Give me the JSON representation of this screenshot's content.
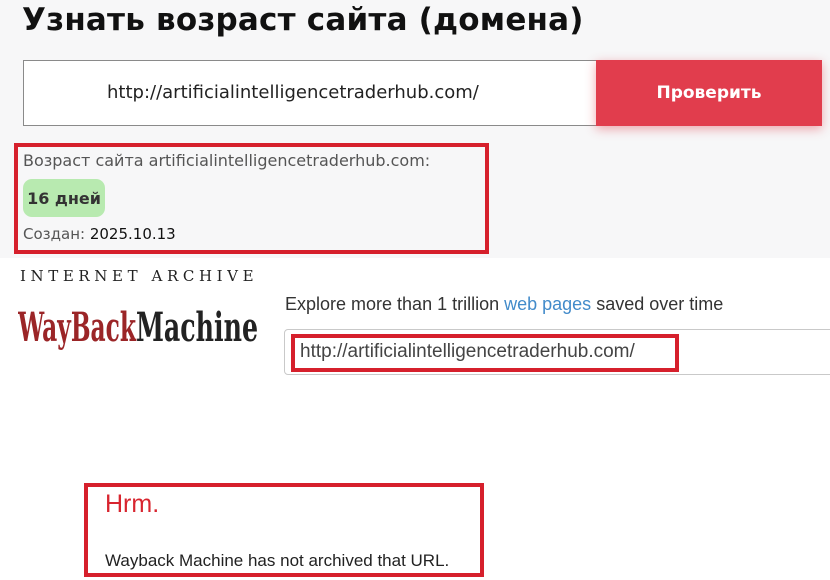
{
  "age_checker": {
    "title": "Узнать возраст сайта (домена)",
    "url_value": "http://artificialintelligencetraderhub.com/",
    "check_button": "Проверить",
    "age_label": "Возраст сайта artificialintelligencetraderhub.com:",
    "age_badge": "16 дней",
    "created_label": "Создан:",
    "created_date": "2025.10.13",
    "badge_color": "#b8eab0",
    "button_color": "#e13d4d",
    "highlight_color": "#d6202c"
  },
  "wayback": {
    "archive_label": "INTERNET ARCHIVE",
    "logo_text_wayback": "WayBack",
    "logo_text_machine": "Machine",
    "explore_before": "Explore more than 1 trillion ",
    "explore_link": "web pages",
    "explore_after": " saved over time",
    "url_value": "http://artificialintelligencetraderhub.com/",
    "error_title": "Hrm.",
    "error_message": "Wayback Machine has not archived that URL.",
    "logo_red": "#9b2527",
    "link_color": "#428bca"
  }
}
